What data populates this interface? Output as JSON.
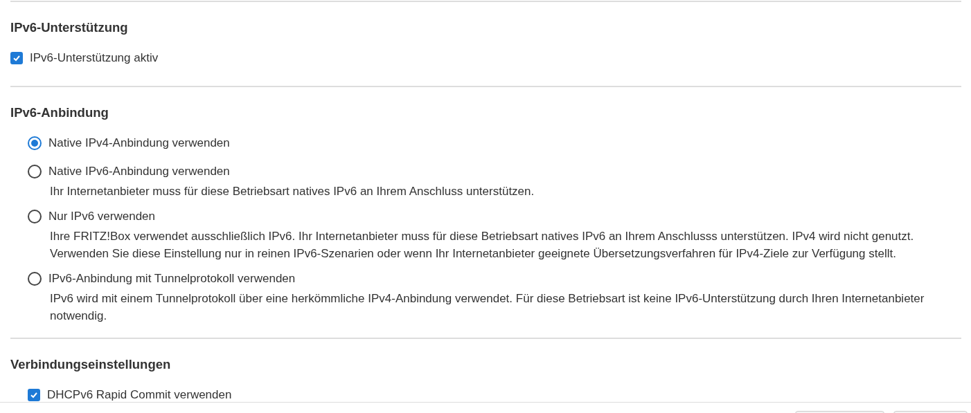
{
  "sections": [
    {
      "title": "IPv6-Unterstützung",
      "options": [
        {
          "kind": "main-checkbox",
          "label": "IPv6-Unterstützung aktiv",
          "checked": true
        }
      ]
    },
    {
      "title": "IPv6-Anbindung",
      "options": [
        {
          "kind": "radio",
          "label": "Native IPv4-Anbindung verwenden",
          "selected": true
        },
        {
          "kind": "radio",
          "label": "Native IPv6-Anbindung verwenden",
          "selected": false,
          "description": "Ihr Internetanbieter muss für diese Betriebsart natives IPv6 an Ihrem Anschluss unterstützen."
        },
        {
          "kind": "radio",
          "label": "Nur IPv6 verwenden",
          "selected": false,
          "description": "Ihre FRITZ!Box verwendet ausschließlich IPv6. Ihr Internetanbieter muss für diese Betriebsart natives IPv6 an Ihrem Anschlusss unterstützen. IPv4 wird nicht genutzt. Verwenden Sie diese Einstellung nur in reinen IPv6-Szenarien oder wenn Ihr Internetanbieter geeignete Übersetzungsverfahren für IPv4-Ziele zur Verfügung stellt."
        },
        {
          "kind": "radio",
          "label": "IPv6-Anbindung mit Tunnelprotokoll verwenden",
          "selected": false,
          "description": "IPv6 wird mit einem Tunnelprotokoll über eine herkömmliche IPv4-Anbindung verwendet. Für diese Betriebsart ist keine IPv6-Unterstützung durch Ihren Internetanbieter notwendig."
        }
      ]
    },
    {
      "title": "Verbindungseinstellungen",
      "options": [
        {
          "kind": "checkbox",
          "label": "DHCPv6 Rapid Commit verwenden",
          "checked": true
        }
      ]
    }
  ]
}
